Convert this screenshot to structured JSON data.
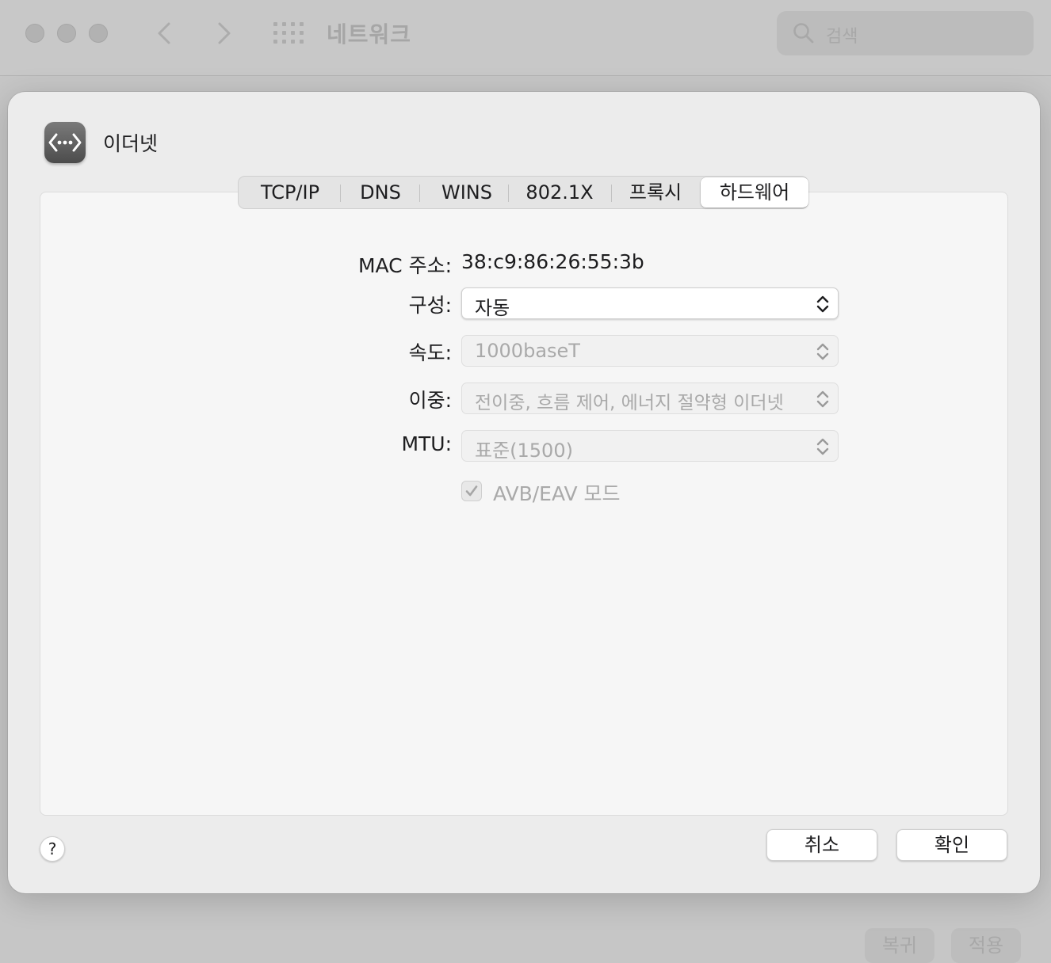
{
  "background": {
    "window_title": "네트워크",
    "search_placeholder": "검색",
    "revert_label": "복귀",
    "apply_label": "적용"
  },
  "sheet": {
    "title": "이더넷",
    "icon": "ethernet-icon",
    "tabs": [
      {
        "label": "TCP/IP",
        "selected": false
      },
      {
        "label": "DNS",
        "selected": false
      },
      {
        "label": "WINS",
        "selected": false
      },
      {
        "label": "802.1X",
        "selected": false
      },
      {
        "label": "프록시",
        "selected": false
      },
      {
        "label": "하드웨어",
        "selected": true
      }
    ],
    "hardware": {
      "mac_label": "MAC 주소:",
      "mac_value": "38:c9:86:26:55:3b",
      "configure_label": "구성:",
      "configure_value": "자동",
      "speed_label": "속도:",
      "speed_value": "1000baseT",
      "duplex_label": "이중:",
      "duplex_value": "전이중, 흐름 제어, 에너지 절약형 이더넷",
      "mtu_label": "MTU:",
      "mtu_value": "표준(1500)",
      "avb_label": "AVB/EAV 모드",
      "avb_checked": true
    },
    "help_label": "?",
    "cancel_label": "취소",
    "ok_label": "확인"
  }
}
